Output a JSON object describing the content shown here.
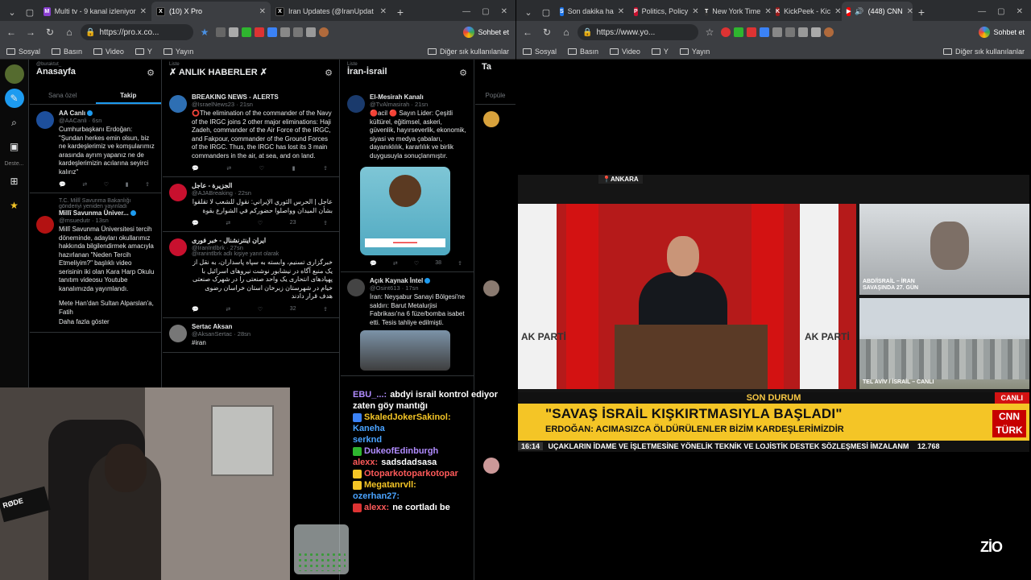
{
  "left_window": {
    "tabs": [
      {
        "label": "Multi tv - 9 kanal izleniyor",
        "fav": "M",
        "color": "#8a3fd1"
      },
      {
        "label": "(10) X Pro",
        "fav": "X",
        "color": "#000000",
        "active": true
      },
      {
        "label": "Iran Updates (@IranUpdat",
        "fav": "X",
        "color": "#000000"
      }
    ],
    "url": "https://pro.x.co...",
    "copilot": "Sohbet et",
    "bookmarks": [
      "Sosyal",
      "Basın",
      "Video",
      "Y",
      "Yayın"
    ],
    "other_bookmarks": "Diğer sık kullanılanlar"
  },
  "right_window": {
    "tabs": [
      {
        "label": "Son dakika ha",
        "fav": "S",
        "color": "#1a73e8"
      },
      {
        "label": "Politics, Policy",
        "fav": "P",
        "color": "#c8102e"
      },
      {
        "label": "New York Time",
        "fav": "T",
        "color": "#333333"
      },
      {
        "label": "KickPeek - Kic",
        "fav": "K",
        "color": "#9b1b1b"
      },
      {
        "label": "(448) CNN",
        "fav": "▶",
        "color": "#ff0000",
        "active": true
      }
    ],
    "url": "https://www.yo...",
    "copilot": "Sohbet et",
    "bookmarks": [
      "Sosyal",
      "Basın",
      "Video",
      "Y",
      "Yayın"
    ],
    "other_bookmarks": "Diğer sık kullanılanlar"
  },
  "rail": {
    "label": "Deste..."
  },
  "columns": [
    {
      "sub": "@buraktut_",
      "title": "Anasayfa",
      "subtabs": [
        "Sana özel",
        "Takip"
      ],
      "tweets": [
        {
          "name": "AA Canlı",
          "handle": "@AACanli · 6sn",
          "text": "Cumhurbaşkanı Erdoğan: \"Şundan herkes emin olsun, biz ne kardeşlerimiz ve komşularımız arasında ayrım yapanız ne de kardeşlerimizin acılarına seyirci kalırız\"",
          "av": "#1d4f9c"
        },
        {
          "rp": "T.C. Millî Savunma Bakanlığı gönderiyi yeniden yayınladı",
          "name": "Millî Savunma Üniver...",
          "handle": "@msuedutr · 13sn",
          "text": "Millî Savunma Üniversitesi tercih döneminde, adayları okullarımız hakkında bilgilendirmek amacıyla hazırlanan \"Neden Tercih Etmeliyim?\" başlıklı video serisinin iki olan Kara Harp Okulu tanıtım videosu Youtube kanalımızda yayımlandı.",
          "extra": "Mete Han'dan Sultan Alparslan'a, Fatih",
          "more": "Daha fazla göster",
          "av": "#b31212"
        }
      ]
    },
    {
      "sub": "Liste",
      "title": "✗ ANLIK HABERLER ✗",
      "tweets": [
        {
          "name": "BREAKING NEWS - ALERTS",
          "handle": "@IsraelNews23 · 21sn",
          "text": "⭕The elimination of the commander of the Navy of the IRGC joins 2 other major eliminations: Haji Zadeh, commander of the Air Force of the IRGC, and Fakpour, commander of the Ground Forces of the IRGC. Thus, the IRGC has lost its 3 main commanders in the air, at sea, and on land.",
          "av": "#2e6fb3",
          "stats": "23"
        },
        {
          "name": "الجزيرة - عاجل",
          "handle": "@AJABreaking · 22sn",
          "text": "عاجل | الحرس الثوري الإيراني: نقول للشعب لا تقلقوا بشأن الميدان وواصلوا حضوركم في الشوارع بقوة",
          "rtl": true,
          "av": "#c8102e",
          "stats": "23"
        },
        {
          "name": "ایران اینترنشنال - خبر فوری",
          "handle": "@IranIntlbrk · 27sn",
          "rp": "@iranintlbrk adlı kişiye yanıt olarak",
          "text": "خبرگزاری تسنیم، وابسته به سپاه پاسداران، به نقل از یک منبع آگاه در نیشابور نوشت نیروهای اسرائیل با پهپادهای انتحاری یک واحد صنعتی را در شهرک صنعتی خیام در شهرستان زبرخان استان خراسان رضوی هدف قرار دادند",
          "rtl": true,
          "av": "#c8102e",
          "stats": "32"
        },
        {
          "name": "Sertac Aksan",
          "handle": "@AksanSertac · 28sn",
          "text": "#iran",
          "av": "#777777"
        }
      ]
    },
    {
      "sub": "Liste",
      "title": "İran-İsrail",
      "tweets": [
        {
          "name": "El-Mesirah Kanalı",
          "handle": "@TvAlmasirah · 21sn",
          "text": "🔴acil 🔴 Sayın Lider: Çeşitli kültürel, eğitimsel, askeri, güvenlik, hayırseverlik, ekonomik, siyasi ve medya çabaları, dayanıklılık, kararlılık ve birlik duygusuyla sonuçlanmıştır.",
          "av": "#1a3a6c",
          "stats": "38"
        },
        {
          "name": "Açık Kaynak İntel",
          "handle": "@Osint613 · 17sn",
          "text": "İran: Neyşabur Sanayi Bölgesi'ne saldırı: Barut Metalurjisi Fabrikası'na 6 füze/bomba isabet etti. Tesis tahliye edilmişti.",
          "av": "#444444"
        }
      ]
    },
    {
      "sub": "",
      "title": "Ta",
      "subtabs": [
        "Popüle"
      ]
    }
  ],
  "video": {
    "city": "ANKARA",
    "akp": "AK PARTİ",
    "pip1": "ABD/İSRAİL – İRAN SAVAŞINDA 27. GÜN",
    "pip2": "TEL AVİV / İSRAİL – CANLI",
    "son_durum": "SON DURUM",
    "canli": "CANLI",
    "headline": "\"SAVAŞ İSRAİL KIŞKIRTMASIYLA BAŞLADI\"",
    "subhead": "ERDOĞAN: ACIMASIZCA ÖLDÜRÜLENLER BİZİM KARDEŞLERİMİZDİR",
    "cnn": "CNN TÜRK",
    "ticker_time": "16:14",
    "ticker": "UÇAKLARIN İDAME VE İŞLETMESİNE YÖNELİK TEKNİK VE LOJİSTİK DESTEK SÖZLEŞMESİ İMZALANM",
    "ticker_value": "12.768",
    "logo": "ZİO"
  },
  "chat": [
    {
      "user": "EBU_...:",
      "text": "abdyi israil kontrol ediyor zaten göy mantığı",
      "color": "#b18cff"
    },
    {
      "user": "SkaledJokerSakinol:",
      "text": "",
      "color": "#f4c526"
    },
    {
      "user": "Kaneha",
      "text": "",
      "color": "#4aa3ff"
    },
    {
      "user": "serknd",
      "text": "",
      "color": "#4aa3ff"
    },
    {
      "user": "DukeofEdinburgh",
      "text": "",
      "color": "#b18cff"
    },
    {
      "user": "alexx:",
      "text": "sadsdadsasa",
      "color": "#ff5a5a"
    },
    {
      "user": "Otoparkotoparkotopar",
      "text": "",
      "color": "#ff5a5a"
    },
    {
      "user": "Megatanrvll:",
      "text": "",
      "color": "#f4c526"
    },
    {
      "user": "ozerhan27:",
      "text": "",
      "color": "#4aa3ff"
    },
    {
      "user": "alexx:",
      "text": "ne cortladı be",
      "color": "#ff5a5a"
    }
  ],
  "cam": {
    "mic": "RØDE"
  }
}
